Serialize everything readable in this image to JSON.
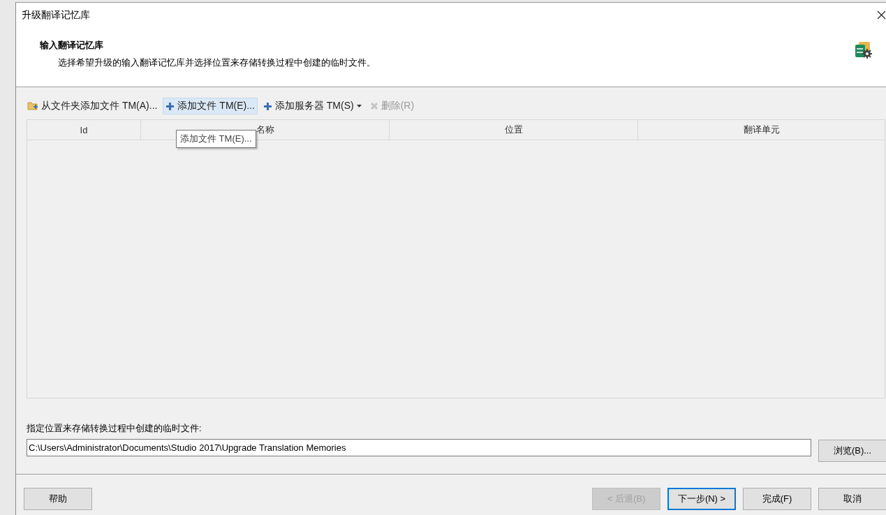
{
  "window": {
    "title": "升级翻译记忆库"
  },
  "header": {
    "title": "输入翻译记忆库",
    "description": "选择希望升级的输入翻译记忆库并选择位置来存储转换过程中创建的临时文件。"
  },
  "toolbar": [
    {
      "label": "从文件夹添加文件 TM(A)...",
      "kind": "folder",
      "hovered": false,
      "disabled": false,
      "dropdown": false
    },
    {
      "label": "添加文件 TM(E)...",
      "kind": "plus",
      "hovered": true,
      "disabled": false,
      "dropdown": false
    },
    {
      "label": "添加服务器 TM(S)",
      "kind": "plus",
      "hovered": false,
      "disabled": false,
      "dropdown": true
    },
    {
      "label": "删除(R)",
      "kind": "delete",
      "hovered": false,
      "disabled": true,
      "dropdown": false
    }
  ],
  "tooltip": "添加文件 TM(E)...",
  "table": {
    "columns": [
      "Id",
      "名称",
      "位置",
      "翻译单元"
    ]
  },
  "location": {
    "label": "指定位置来存储转换过程中创建的临时文件:",
    "value": "C:\\Users\\Administrator\\Documents\\Studio 2017\\Upgrade Translation Memories",
    "browse": "浏览(B)..."
  },
  "buttons": [
    {
      "label": "帮助",
      "disabled": false,
      "focused": false
    },
    {
      "label": "< 后退(B)",
      "disabled": true,
      "focused": false
    },
    {
      "label": "下一步(N) >",
      "disabled": false,
      "focused": true
    },
    {
      "label": "完成(F)",
      "disabled": false,
      "focused": false
    },
    {
      "label": "取消",
      "disabled": false,
      "focused": false
    }
  ]
}
